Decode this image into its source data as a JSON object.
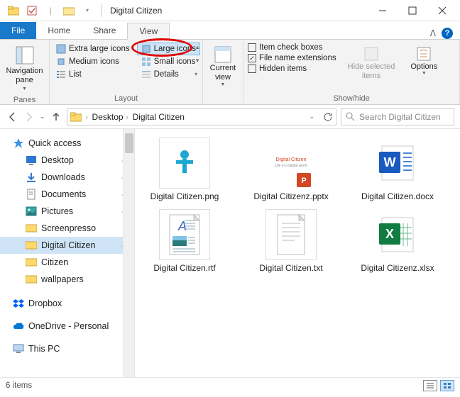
{
  "window": {
    "title": "Digital Citizen"
  },
  "tabs": {
    "file": "File",
    "home": "Home",
    "share": "Share",
    "view": "View"
  },
  "ribbon": {
    "panes_label": "Panes",
    "navpane": "Navigation\npane",
    "layout_label": "Layout",
    "layout": {
      "xl": "Extra large icons",
      "lg": "Large icons",
      "md": "Medium icons",
      "sm": "Small icons",
      "list": "List",
      "details": "Details"
    },
    "currentview": "Current\nview",
    "showhide_label": "Show/hide",
    "checks": {
      "itemcheck": "Item check boxes",
      "ext": "File name extensions",
      "hidden": "Hidden items"
    },
    "hidesel": "Hide selected\nitems",
    "options": "Options"
  },
  "breadcrumb": {
    "a": "Desktop",
    "b": "Digital Citizen"
  },
  "search": {
    "placeholder": "Search Digital Citizen"
  },
  "tree": {
    "quick": "Quick access",
    "desktop": "Desktop",
    "downloads": "Downloads",
    "documents": "Documents",
    "pictures": "Pictures",
    "screenpresso": "Screenpresso",
    "dc": "Digital Citizen",
    "citizen": "Citizen",
    "wallpapers": "wallpapers",
    "dropbox": "Dropbox",
    "onedrive": "OneDrive - Personal",
    "thispc": "This PC"
  },
  "files": [
    {
      "name": "Digital Citizen.png"
    },
    {
      "name": "Digital Citizenz.pptx"
    },
    {
      "name": "Digital Citizen.docx"
    },
    {
      "name": "Digital Citizen.rtf"
    },
    {
      "name": "Digital Citizen.txt"
    },
    {
      "name": "Digital Citizenz.xlsx"
    }
  ],
  "status": {
    "count": "6 items"
  }
}
